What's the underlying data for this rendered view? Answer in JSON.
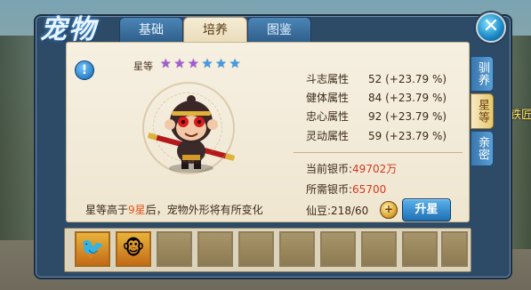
{
  "window": {
    "title_logo": "宠物",
    "close_label": "✕"
  },
  "tabs": [
    {
      "label": "基础",
      "active": false
    },
    {
      "label": "培养",
      "active": true
    },
    {
      "label": "图鉴",
      "active": false
    }
  ],
  "side_text": "铁匠",
  "star_rank": {
    "label": "星等",
    "stars": [
      {
        "color": "purple"
      },
      {
        "color": "purple"
      },
      {
        "color": "purple"
      },
      {
        "color": "blue"
      },
      {
        "color": "blue"
      },
      {
        "color": "blue"
      }
    ]
  },
  "stats": [
    {
      "name": "斗志属性",
      "value": "52 (+23.79 %)"
    },
    {
      "name": "健体属性",
      "value": "84 (+23.79 %)"
    },
    {
      "name": "忠心属性",
      "value": "92 (+23.79 %)"
    },
    {
      "name": "灵动属性",
      "value": "59 (+23.79 %)"
    }
  ],
  "money": {
    "current_label": "当前银币:",
    "current_value": "49702万",
    "required_label": "所需银币:",
    "required_value": "65700",
    "beans": "仙豆:218/60"
  },
  "upgrade_button": "升星",
  "hint": {
    "before": "星等高于",
    "highlight": "9星",
    "after": "后，宠物外形将有所变化"
  },
  "side_tabs": [
    {
      "label": "驯养",
      "active": false
    },
    {
      "label": "星等",
      "active": true
    },
    {
      "label": "亲密",
      "active": false
    }
  ],
  "slots": [
    {
      "icon": "phoenix-icon",
      "glyph": "🐦"
    },
    {
      "icon": "monkey-icon",
      "glyph": "🐵"
    },
    {
      "icon": "empty-slot"
    },
    {
      "icon": "empty-slot"
    },
    {
      "icon": "empty-slot"
    },
    {
      "icon": "empty-slot"
    },
    {
      "icon": "empty-slot"
    },
    {
      "icon": "empty-slot"
    },
    {
      "icon": "empty-slot"
    },
    {
      "icon": "empty-slot"
    }
  ],
  "colors": {
    "frame": "#2d4a66",
    "panel": "#f6f0e2",
    "accent_red": "#d23a1e",
    "button_blue": "#1f6fb4"
  }
}
